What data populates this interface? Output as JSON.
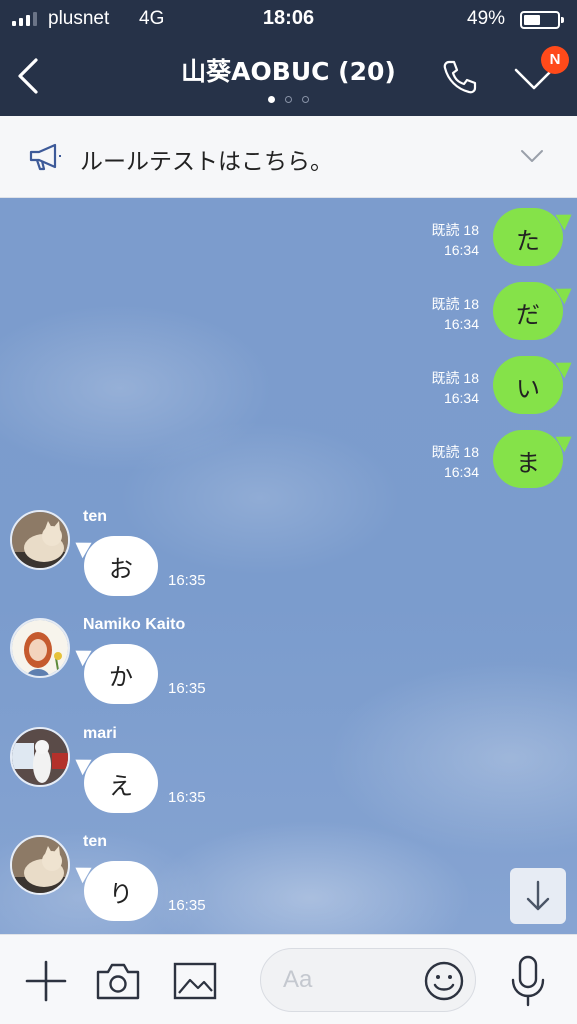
{
  "status_bar": {
    "carrier": "plusnet",
    "network": "4G",
    "time": "18:06",
    "battery_percent": "49%"
  },
  "header": {
    "title": "山葵AOBUC (20)",
    "notification_badge": "N",
    "page_indicator": {
      "pages": 3,
      "active": 1
    }
  },
  "announcement": {
    "text": "ルールテストはこちら。"
  },
  "outgoing": [
    {
      "text": "た",
      "read": "既読 18",
      "time": "16:34"
    },
    {
      "text": "だ",
      "read": "既読 18",
      "time": "16:34"
    },
    {
      "text": "い",
      "read": "既読 18",
      "time": "16:34"
    },
    {
      "text": "ま",
      "read": "既読 18",
      "time": "16:34"
    }
  ],
  "incoming": [
    {
      "sender": "ten",
      "text": "お",
      "time": "16:35",
      "avatar": "cat-photo"
    },
    {
      "sender": "Namiko Kaito",
      "text": "か",
      "time": "16:35",
      "avatar": "illustrated-girl"
    },
    {
      "sender": "mari",
      "text": "え",
      "time": "16:35",
      "avatar": "dog-photo"
    },
    {
      "sender": "ten",
      "text": "り",
      "time": "16:35",
      "avatar": "cat-photo"
    }
  ],
  "input": {
    "placeholder": "Aa",
    "value": ""
  },
  "colors": {
    "header_bg": "#263248",
    "chat_bg": "#7e9ccb",
    "outgoing_bubble": "#85e249",
    "incoming_bubble": "#ffffff",
    "badge": "#ff4a1a"
  }
}
